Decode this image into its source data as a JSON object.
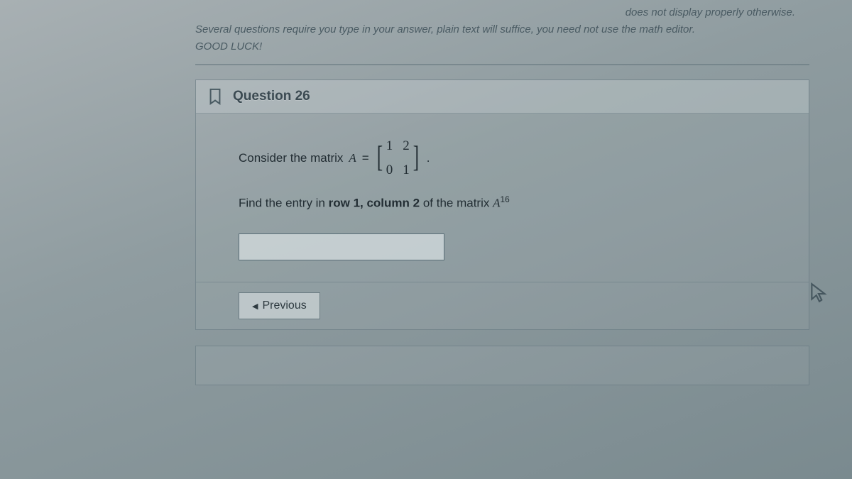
{
  "instructions": {
    "line1_suffix": "does not display properly otherwise.",
    "line2": "Several questions require you type in your answer, plain text will suffice, you need not use the math editor.",
    "line3": "GOOD LUCK!"
  },
  "question": {
    "title": "Question 26",
    "consider_prefix": "Consider the matrix ",
    "matrix_var": "A",
    "equals": " =",
    "matrix": {
      "r1c1": "1",
      "r1c2": "2",
      "r2c1": "0",
      "r2c2": "1"
    },
    "find_prefix": "Find the entry in ",
    "find_bold": "row 1, column 2",
    "find_suffix": " of the matrix ",
    "power_var": "A",
    "power_exp": "16"
  },
  "nav": {
    "previous_label": "Previous"
  }
}
